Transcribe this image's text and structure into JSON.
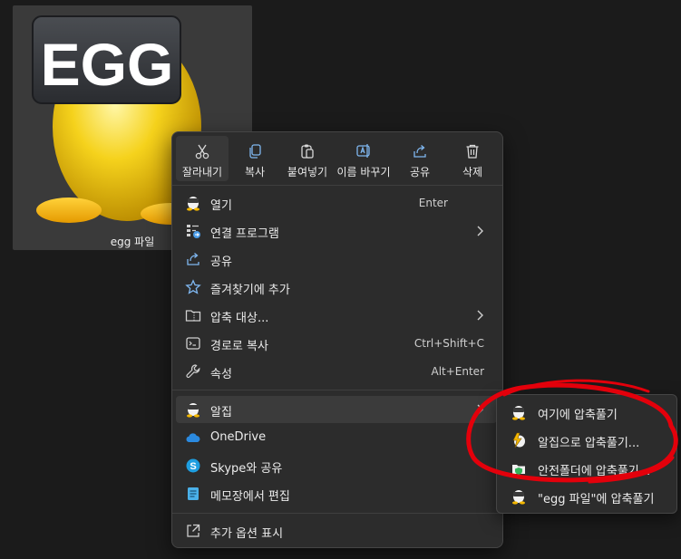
{
  "file": {
    "name": "egg 파일",
    "thumbnail_text": "EGG"
  },
  "quick_actions": [
    {
      "label": "잘라내기",
      "icon": "scissors-icon"
    },
    {
      "label": "복사",
      "icon": "copy-icon"
    },
    {
      "label": "붙여넣기",
      "icon": "paste-icon"
    },
    {
      "label": "이름 바꾸기",
      "icon": "rename-icon"
    },
    {
      "label": "공유",
      "icon": "share-icon"
    },
    {
      "label": "삭제",
      "icon": "trash-icon"
    }
  ],
  "menu_items": [
    {
      "label": "열기",
      "shortcut": "Enter",
      "icon": "alzip-icon"
    },
    {
      "label": "연결 프로그램",
      "icon": "open-with-icon"
    },
    {
      "label": "공유",
      "icon": "share-icon"
    },
    {
      "label": "즐겨찾기에 추가",
      "icon": "star-icon"
    },
    {
      "label": "압축 대상...",
      "icon": "zip-folder-icon"
    },
    {
      "label": "경로로 복사",
      "shortcut": "Ctrl+Shift+C",
      "icon": "copy-path-icon"
    },
    {
      "label": "속성",
      "shortcut": "Alt+Enter",
      "icon": "wrench-icon"
    },
    {
      "label": "알집",
      "icon": "alzip-icon"
    },
    {
      "label": "OneDrive",
      "icon": "onedrive-icon"
    },
    {
      "label": "Skype와 공유",
      "icon": "skype-icon"
    },
    {
      "label": "메모장에서 편집",
      "icon": "notepad-icon"
    },
    {
      "label": "추가 옵션 표시",
      "icon": "more-options-icon"
    }
  ],
  "submenu_items": [
    {
      "label": "여기에 압축풀기",
      "icon": "alzip-icon"
    },
    {
      "label": "알집으로 압축풀기...",
      "icon": "alzip-bolt-icon"
    },
    {
      "label": "안전폴더에 압축풀기...",
      "icon": "safe-folder-icon"
    },
    {
      "label": "\"egg 파일\"에 압축풀기",
      "icon": "alzip-icon"
    }
  ],
  "colors": {
    "menu_bg": "#2c2c2c",
    "accent_blue": "#4a9ce8",
    "annotation_red": "#e3000b"
  }
}
